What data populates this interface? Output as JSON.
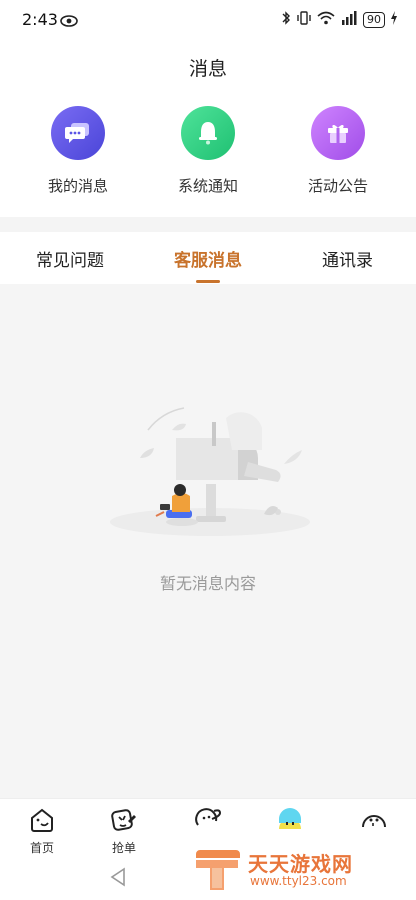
{
  "status_bar": {
    "time": "2:43",
    "battery": "90"
  },
  "header": {
    "title": "消息"
  },
  "quick_actions": [
    {
      "label": "我的消息",
      "icon": "chat-bubble-icon",
      "color": "#5b55e6"
    },
    {
      "label": "系统通知",
      "icon": "bell-icon",
      "color": "#2bcf7e"
    },
    {
      "label": "活动公告",
      "icon": "gift-icon",
      "color": "#b064ef"
    }
  ],
  "tabs": [
    {
      "label": "常见问题",
      "active": false
    },
    {
      "label": "客服消息",
      "active": true
    },
    {
      "label": "通讯录",
      "active": false
    }
  ],
  "empty_state": {
    "text": "暂无消息内容"
  },
  "bottom_nav": [
    {
      "label": "首页",
      "icon": "home-face-icon"
    },
    {
      "label": "抢单",
      "icon": "grab-order-icon"
    },
    {
      "label": "",
      "icon": "planet-face-icon"
    },
    {
      "label": "",
      "icon": "avatar-icon"
    },
    {
      "label": "",
      "icon": "profile-face-icon"
    }
  ],
  "watermark": {
    "text": "天天游戏网",
    "url": "www.ttyl23.com"
  },
  "colors": {
    "accent": "#c8732c",
    "background_content": "#f5f5f5"
  }
}
